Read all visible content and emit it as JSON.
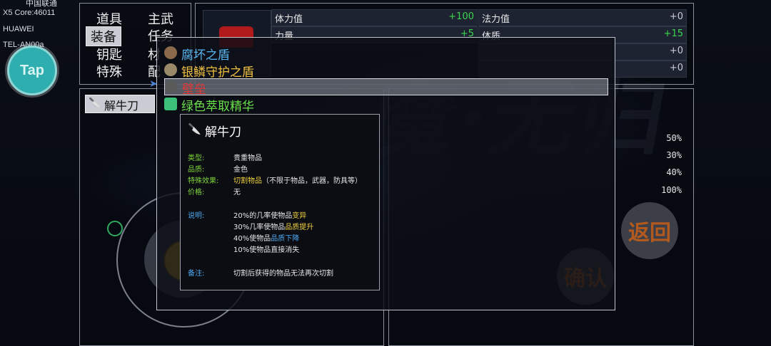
{
  "status_bar": {
    "carrier": "中国联通",
    "core": "X5 Core:46011",
    "brand": "HUAWEI",
    "model": "TEL-AN00a"
  },
  "tap_button": "Tap",
  "categories": [
    {
      "label": "道具",
      "selected": false
    },
    {
      "label": "主武",
      "selected": false
    },
    {
      "label": "装备",
      "selected": true
    },
    {
      "label": "任务",
      "selected": false
    },
    {
      "label": "钥匙",
      "selected": false
    },
    {
      "label": "材",
      "selected": false
    },
    {
      "label": "特殊",
      "selected": false
    },
    {
      "label": "配",
      "selected": false
    }
  ],
  "stats": {
    "stamina_label": "体力值",
    "stamina_value": "+100",
    "mana_label": "法力值",
    "mana_value": "+0",
    "strength_label": "力量",
    "strength_value": "+5",
    "physique_label": "体质",
    "physique_value": "+15",
    "row3_value": "+0",
    "row4_value": "+0"
  },
  "weapon_tag": "解牛刀",
  "percentages": [
    "50%",
    "30%",
    "40%",
    "100%"
  ],
  "buttons": {
    "back": "返回",
    "confirm": "确认"
  },
  "item_list": [
    {
      "name": "腐坏之盾",
      "color": "#58b6f0",
      "icon_color": "#8a6a4a"
    },
    {
      "name": "银鳞守护之盾",
      "color": "#f0c040",
      "icon_color": "#9a8a6a"
    },
    {
      "name": "壁垒",
      "color": "#e03a3a",
      "icon_color": "#5a5a5a",
      "selected": true
    },
    {
      "name": "绿色萃取精华",
      "color": "#6ae04a",
      "icon_color": "#3cc07a"
    }
  ],
  "tooltip": {
    "title": "解牛刀",
    "type_key": "类型:",
    "type_val": "贵重物品",
    "quality_key": "品质:",
    "quality_val": "金色",
    "effect_key": "特殊效果:",
    "effect_val_a": "切割物品",
    "effect_val_b": "（不限于物品，武器，防具等）",
    "price_key": "价格:",
    "price_val": "无",
    "desc_key": "说明:",
    "desc_1a": "20%的几率使物品",
    "desc_1b": "变异",
    "desc_2a": "30%几率使物品",
    "desc_2b": "品质提升",
    "desc_3a": "40%使物品",
    "desc_3b": "品质下降",
    "desc_4": "10%使物品直接消失",
    "note_key": "备注:",
    "note_val": "切割后获得的物品无法再次切割"
  },
  "colors": {
    "key_green": "#7fd63a",
    "key_blue": "#4aa8f0",
    "highlight_yellow": "#f0d040",
    "highlight_blue": "#4aa8f0"
  }
}
